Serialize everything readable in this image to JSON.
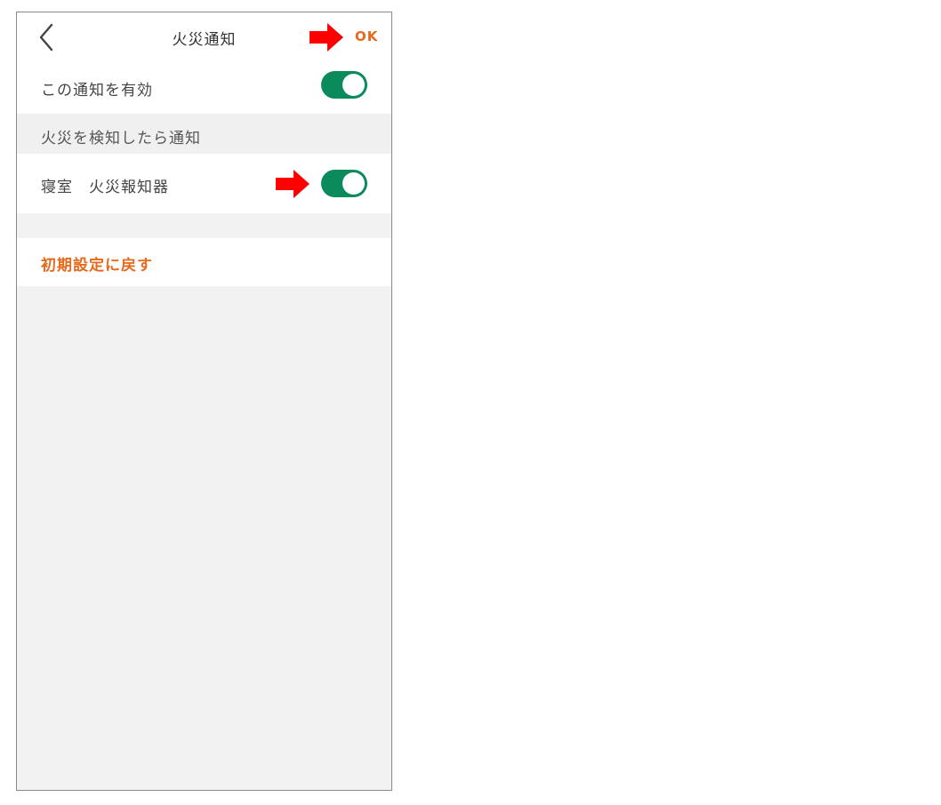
{
  "nav": {
    "back_icon": "chevron-left-icon",
    "title": "火災通知",
    "ok_label": "OK"
  },
  "enable_row": {
    "label": "この通知を有効",
    "toggle_on": true
  },
  "section": {
    "header": "火災を検知したら通知"
  },
  "device_row": {
    "label": "寝室　火災報知器",
    "toggle_on": true
  },
  "reset": {
    "label": "初期設定に戻す"
  },
  "annotations": {
    "arrow_icon": "red-right-arrow-icon",
    "arrow_color": "#ff0000"
  },
  "colors": {
    "accent": "#e66a1d",
    "toggle_on": "#0b8a5c",
    "background": "#f2f2f2"
  }
}
